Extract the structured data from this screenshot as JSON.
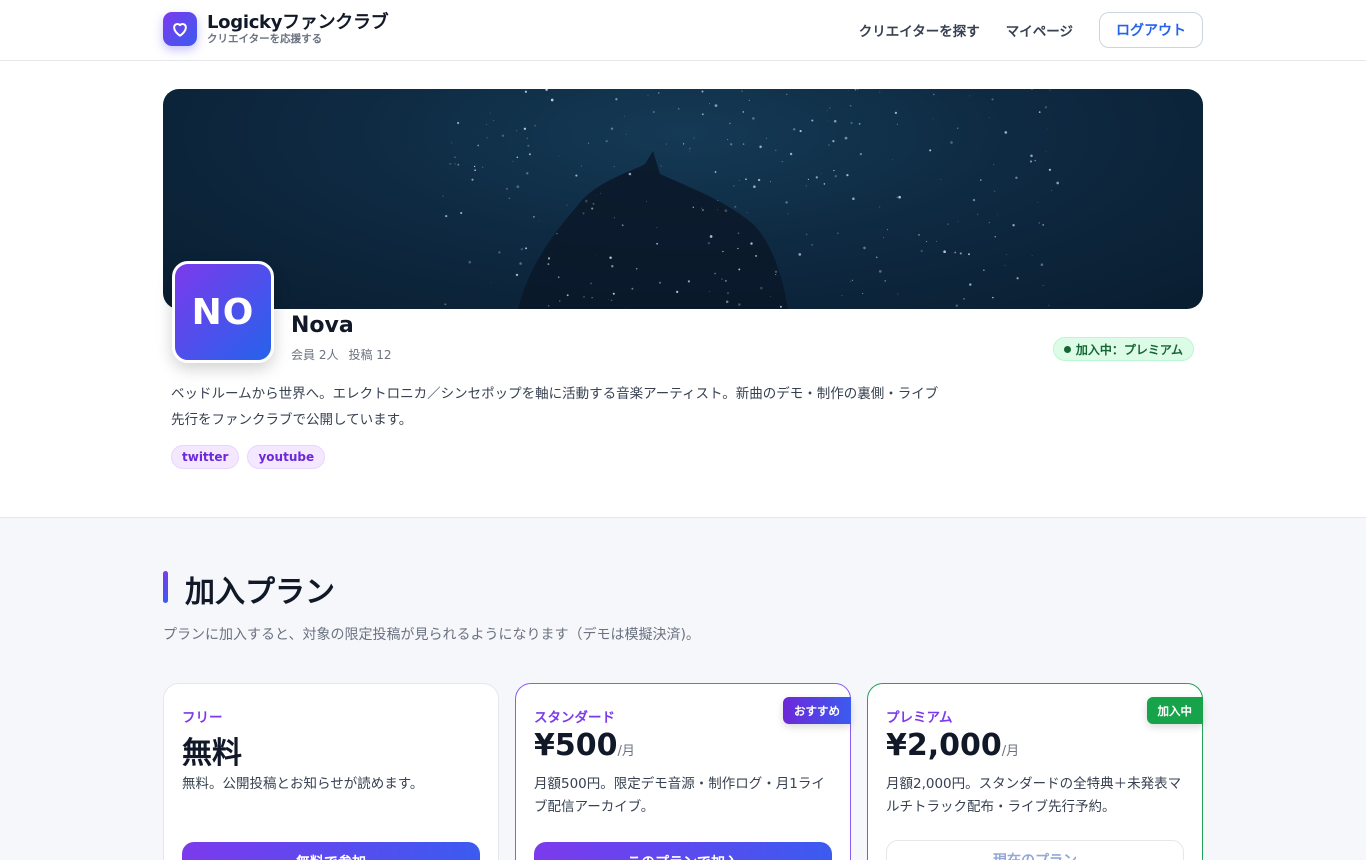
{
  "header": {
    "brand_title": "Logickyファンクラブ",
    "brand_subtitle": "クリエイターを応援する",
    "nav_find": "クリエイターを探す",
    "nav_mypage": "マイページ",
    "logout_label": "ログアウト"
  },
  "creator": {
    "avatar_initials": "NO",
    "name": "Nova",
    "members": "会員 2人",
    "posts": "投稿 12",
    "status": "加入中：プレミアム",
    "bio": "ベッドルームから世界へ。エレクトロニカ／シンセポップを軸に活動する音楽アーティスト。新曲のデモ・制作の裏側・ライブ先行をファンクラブで公開しています。",
    "tags": [
      "twitter",
      "youtube"
    ]
  },
  "plans_section": {
    "title": "加入プラン",
    "description": "プランに加入すると、対象の限定投稿が見られるようになります（デモは模擬決済)。"
  },
  "plans": [
    {
      "name": "フリー",
      "price": "無料",
      "unit": "",
      "description": "無料。公開投稿とお知らせが読めます。",
      "button": "無料で参加",
      "ribbon": ""
    },
    {
      "name": "スタンダード",
      "price": "¥500",
      "unit": "/月",
      "description": "月額500円。限定デモ音源・制作ログ・月1ライブ配信アーカイブ。",
      "button": "このプランで加入",
      "ribbon": "おすすめ"
    },
    {
      "name": "プレミアム",
      "price": "¥2,000",
      "unit": "/月",
      "description": "月額2,000円。スタンダードの全特典＋未発表マルチトラック配布・ライブ先行予約。",
      "button": "現在のプラン",
      "ribbon": "加入中"
    }
  ],
  "colors": {
    "accent_purple": "#7c3aed",
    "accent_blue": "#3b5bf0",
    "joined_green": "#16a34a"
  }
}
